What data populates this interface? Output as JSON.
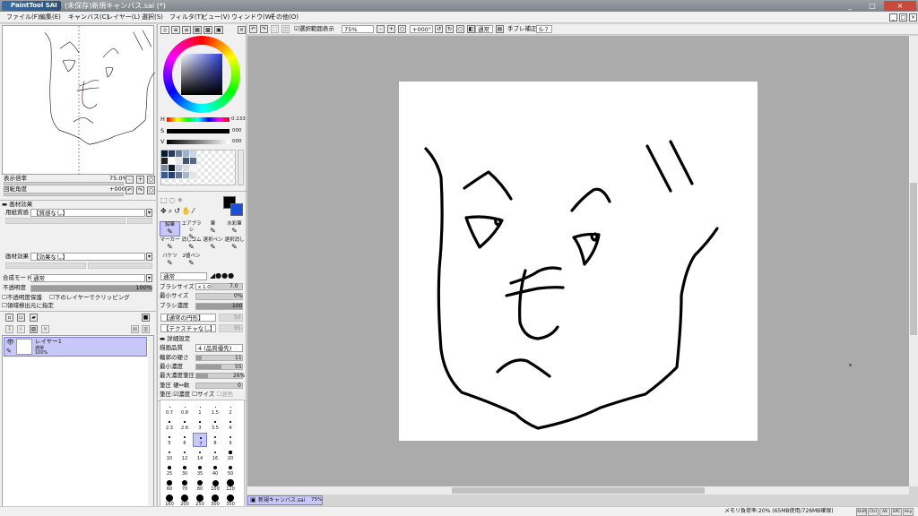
{
  "titlebar": {
    "logo": "PaintTool SAI",
    "title": "(未保存)新規キャンバス.sai (*)",
    "min": "_",
    "max": "□",
    "close": "×"
  },
  "menu": [
    "ファイル(F)",
    "編集(E)",
    "キャンバス(C)",
    "レイヤー(L)",
    "選択(S)",
    "フィルタ(T)",
    "ビュー(V)",
    "ウィンドウ(W)",
    "その他(O)"
  ],
  "navigator": {
    "zoom_label": "表示倍率",
    "zoom_value": "75.0%",
    "rotate_label": "回転角度",
    "rotate_value": "+000°"
  },
  "paper": {
    "header": "画材効果",
    "texture_label": "用紙質感",
    "texture_value": "【質感なし】",
    "effect_label": "画材効果",
    "effect_value": "【効果なし】"
  },
  "layerprops": {
    "blend_label": "合成モード",
    "blend_value": "通常",
    "opacity_label": "不透明度",
    "opacity_value": "100%",
    "preserve": "不透明度保護",
    "clip": "下のレイヤーでクリッピング",
    "selsrc": "領域検出元に指定"
  },
  "layer": {
    "name": "レイヤー1",
    "mode": "通常",
    "opacity": "100%"
  },
  "color": {
    "h_label": "H",
    "h_value": "0.133",
    "s_label": "S",
    "s_value": "000",
    "v_label": "V",
    "v_value": "000",
    "fg": "#000000",
    "bg": "#1a4fd6"
  },
  "swatches": [
    "#0b1a33",
    "#2b3a55",
    "#6f7d95",
    "#9db0c9",
    "#c9d6e6",
    "#222",
    "#ffffff",
    "#e8e8e8",
    "#44546a",
    "#5a6b84",
    "#7788a0",
    "#111827",
    "#c0c8d4",
    "#dcdcdc",
    "#f4f4f4",
    "#3c5a8c",
    "#28406a",
    "#6a7a8a",
    "#a7b7c7",
    "#e3e3e3",
    "#a28766",
    "#5b3c22",
    "#8a6a4a",
    "#cbb494",
    "#eeeeee"
  ],
  "tools": [
    {
      "label": "鉛筆",
      "sel": true
    },
    {
      "label": "エアブラシ",
      "sel": false
    },
    {
      "label": "筆",
      "sel": false
    },
    {
      "label": "水彩筆",
      "sel": false
    },
    {
      "label": "マーカー",
      "sel": false
    },
    {
      "label": "消しゴム",
      "sel": false
    },
    {
      "label": "選択ペン",
      "sel": false
    },
    {
      "label": "選択消し",
      "sel": false
    },
    {
      "label": "バケツ",
      "sel": false
    },
    {
      "label": "2値ペン",
      "sel": false
    }
  ],
  "brush": {
    "blend": "通常",
    "size_label": "ブラシサイズ",
    "size_mult": "x 1.0",
    "size_value": "7.0",
    "min_label": "最小サイズ",
    "min_value": "0%",
    "density_label": "ブラシ濃度",
    "density_value": "100",
    "shape": "【通常の円形】",
    "shape_val": "50",
    "texture": "【テクスチャなし】",
    "texture_val": "95"
  },
  "detail": {
    "header": "詳細設定",
    "quality_label": "描画品質",
    "quality_value": "4 (品質優先)",
    "edge_label": "輪郭の硬さ",
    "edge_value": "11",
    "mindens_label": "最小濃度",
    "mindens_value": "55",
    "maxpress_label": "最大濃度筆圧",
    "maxpress_value": "26%",
    "hard_label": "筆圧 硬⇔軟",
    "hard_value": "0",
    "press_label": "筆圧:",
    "dens": "濃度",
    "size": "サイズ",
    "blend2": "混色"
  },
  "sizes": [
    "0.7",
    "0.8",
    "1",
    "1.5",
    "2",
    "2.3",
    "2.6",
    "3",
    "3.5",
    "4",
    "5",
    "6",
    "7",
    "8",
    "9",
    "10",
    "12",
    "14",
    "16",
    "20",
    "25",
    "30",
    "35",
    "40",
    "50",
    "60",
    "70",
    "80",
    "100",
    "120",
    "160",
    "200",
    "250",
    "300",
    "350"
  ],
  "canvas_toolbar": {
    "show_sel": "選択範囲表示",
    "zoom": "75%",
    "rotate": "+000°",
    "mode": "通常",
    "stab_label": "手ブレ補正",
    "stab_value": "S-7"
  },
  "tab": {
    "name": "新規キャンバス.sai",
    "zoom": "75%"
  },
  "status": {
    "mem": "メモリ負荷率:20% (65MB使用/726MB確保)",
    "keys": [
      "Shift",
      "Ctrl",
      "Alt",
      "SPC",
      "Any"
    ]
  }
}
